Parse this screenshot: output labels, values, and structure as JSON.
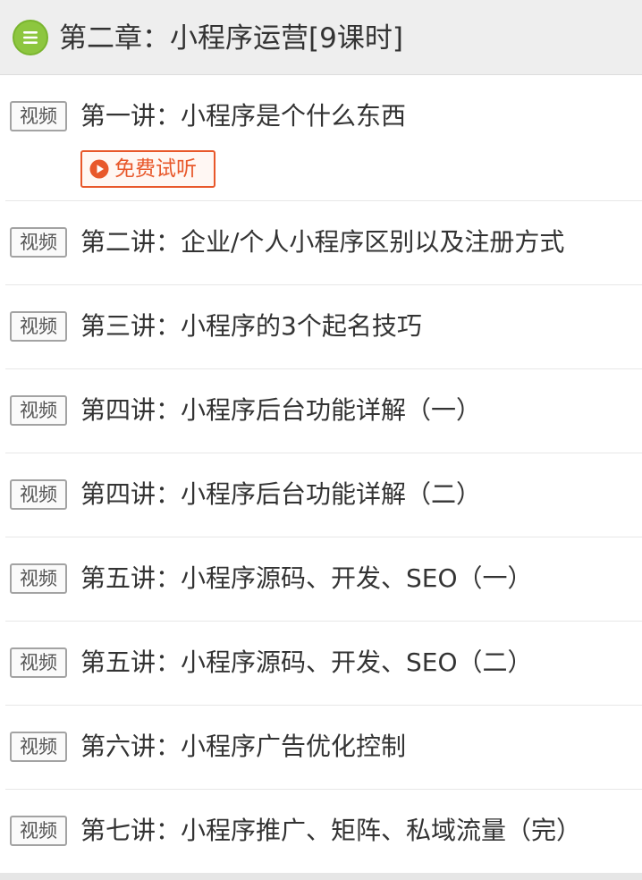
{
  "chapter": {
    "title": "第二章：小程序运营[9课时]",
    "icon": "list-menu-icon",
    "icon_color": "#8dc63f"
  },
  "lessons": [
    {
      "badge": "视频",
      "title": "第一讲：小程序是个什么东西",
      "free_trial": "免费试听"
    },
    {
      "badge": "视频",
      "title": "第二讲：企业/个人小程序区别以及注册方式"
    },
    {
      "badge": "视频",
      "title": "第三讲：小程序的3个起名技巧"
    },
    {
      "badge": "视频",
      "title": "第四讲：小程序后台功能详解（一）"
    },
    {
      "badge": "视频",
      "title": "第四讲：小程序后台功能详解（二）"
    },
    {
      "badge": "视频",
      "title": "第五讲：小程序源码、开发、SEO（一）"
    },
    {
      "badge": "视频",
      "title": "第五讲：小程序源码、开发、SEO（二）"
    },
    {
      "badge": "视频",
      "title": "第六讲：小程序广告优化控制"
    },
    {
      "badge": "视频",
      "title": "第七讲：小程序推广、矩阵、私域流量（完）"
    }
  ],
  "colors": {
    "accent": "#e8582b",
    "header_bg": "#eeeeee"
  }
}
